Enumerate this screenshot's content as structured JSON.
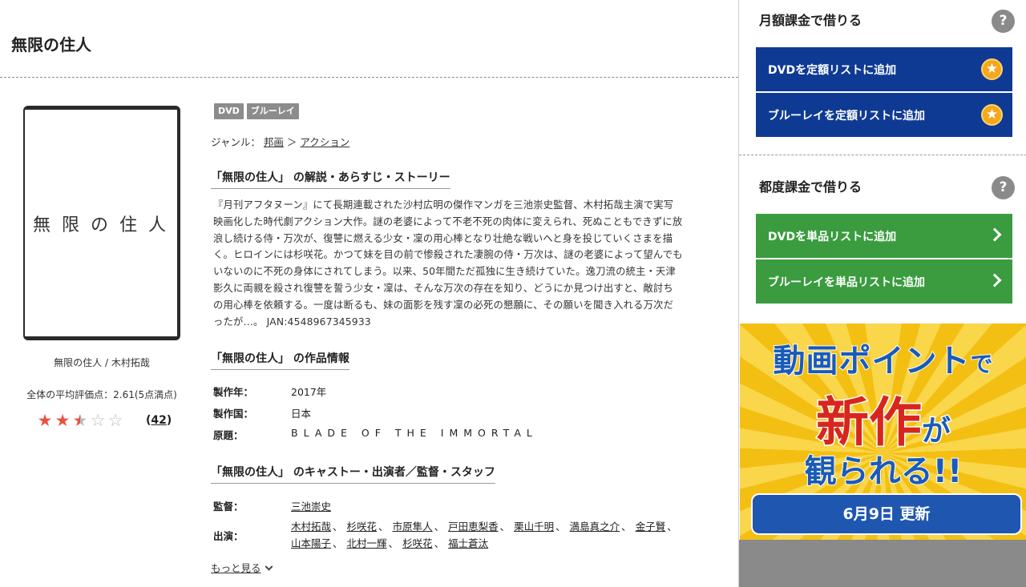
{
  "page": {
    "title": "無限の住人"
  },
  "cover": {
    "title_text": "無限の住人",
    "caption": "無限の住人 / 木村拓哉"
  },
  "rating": {
    "average_text": "全体の平均評価点：2.61(5点満点)",
    "value": 2.61,
    "max": 5,
    "review_count": "42",
    "review_count_open": "(",
    "review_count_close": ")"
  },
  "tags": [
    "DVD",
    "ブルーレイ"
  ],
  "genre": {
    "label": "ジャンル：",
    "items": [
      "邦画",
      "アクション"
    ],
    "separator": "＞"
  },
  "synopsis": {
    "heading": "「無限の住人」 の解説・あらすじ・ストーリー",
    "text": "『月刊アフタヌーン』にて長期連載された沙村広明の傑作マンガを三池崇史監督、木村拓哉主演で実写映画化した時代劇アクション大作。謎の老婆によって不老不死の肉体に変えられ、死ぬこともできずに放浪し続ける侍・万次が、復讐に燃える少女・凜の用心棒となり壮絶な戦いへと身を投じていくさまを描く。ヒロインには杉咲花。かつて妹を目の前で惨殺された凄腕の侍・万次は、謎の老婆によって望んでもいないのに不死の身体にされてしまう。以来、50年間ただ孤独に生き続けていた。逸刀流の統主・天津影久に両親を殺され復讐を誓う少女・凜は、そんな万次の存在を知り、どうにか見つけ出すと、敵討ちの用心棒を依頼する。一度は断るも、妹の面影を残す凜の必死の懇願に、その願いを聞き入れる万次だったが…。 JAN:4548967345933"
  },
  "work_info": {
    "heading": "「無限の住人」 の作品情報",
    "rows": [
      {
        "label": "製作年：",
        "value": "2017年"
      },
      {
        "label": "製作国：",
        "value": "日本"
      },
      {
        "label": "原題：",
        "value": "BLADE OF THE IMMORTAL"
      }
    ]
  },
  "cast": {
    "heading": "「無限の住人」 のキャストー・出演者／監督・スタッフ",
    "director_label": "監督：",
    "director": "三池崇史",
    "cast_label": "出演：",
    "members": [
      "木村拓哉",
      "杉咲花",
      "市原隼人",
      "戸田恵梨香",
      "栗山千明",
      "満島真之介",
      "金子賢",
      "山本陽子",
      "北村一輝",
      "杉咲花",
      "福士蒼汰"
    ],
    "separator": "、",
    "more_label": "もっと見る"
  },
  "sidebar": {
    "monthly": {
      "heading": "月額課金で借りる",
      "help_label": "?",
      "buttons": [
        {
          "label": "DVDを定額リストに追加",
          "badge": "★"
        },
        {
          "label": "ブルーレイを定額リストに追加",
          "badge": "★"
        }
      ]
    },
    "single": {
      "heading": "都度課金で借りる",
      "help_label": "?",
      "buttons": [
        {
          "label": "DVDを単品リストに追加"
        },
        {
          "label": "ブルーレイを単品リストに追加"
        }
      ]
    },
    "banner": {
      "line1_main": "動画ポイント",
      "line1_small": "で",
      "line2_main": "新作",
      "line2_small": "が",
      "line3": "観られる!!",
      "date": "6月9日 更新"
    }
  },
  "colors": {
    "monthly_button": "#0f3a94",
    "single_button": "#3a9c3f",
    "star_filled": "#e8523f",
    "banner_bg": "#f6c721"
  }
}
